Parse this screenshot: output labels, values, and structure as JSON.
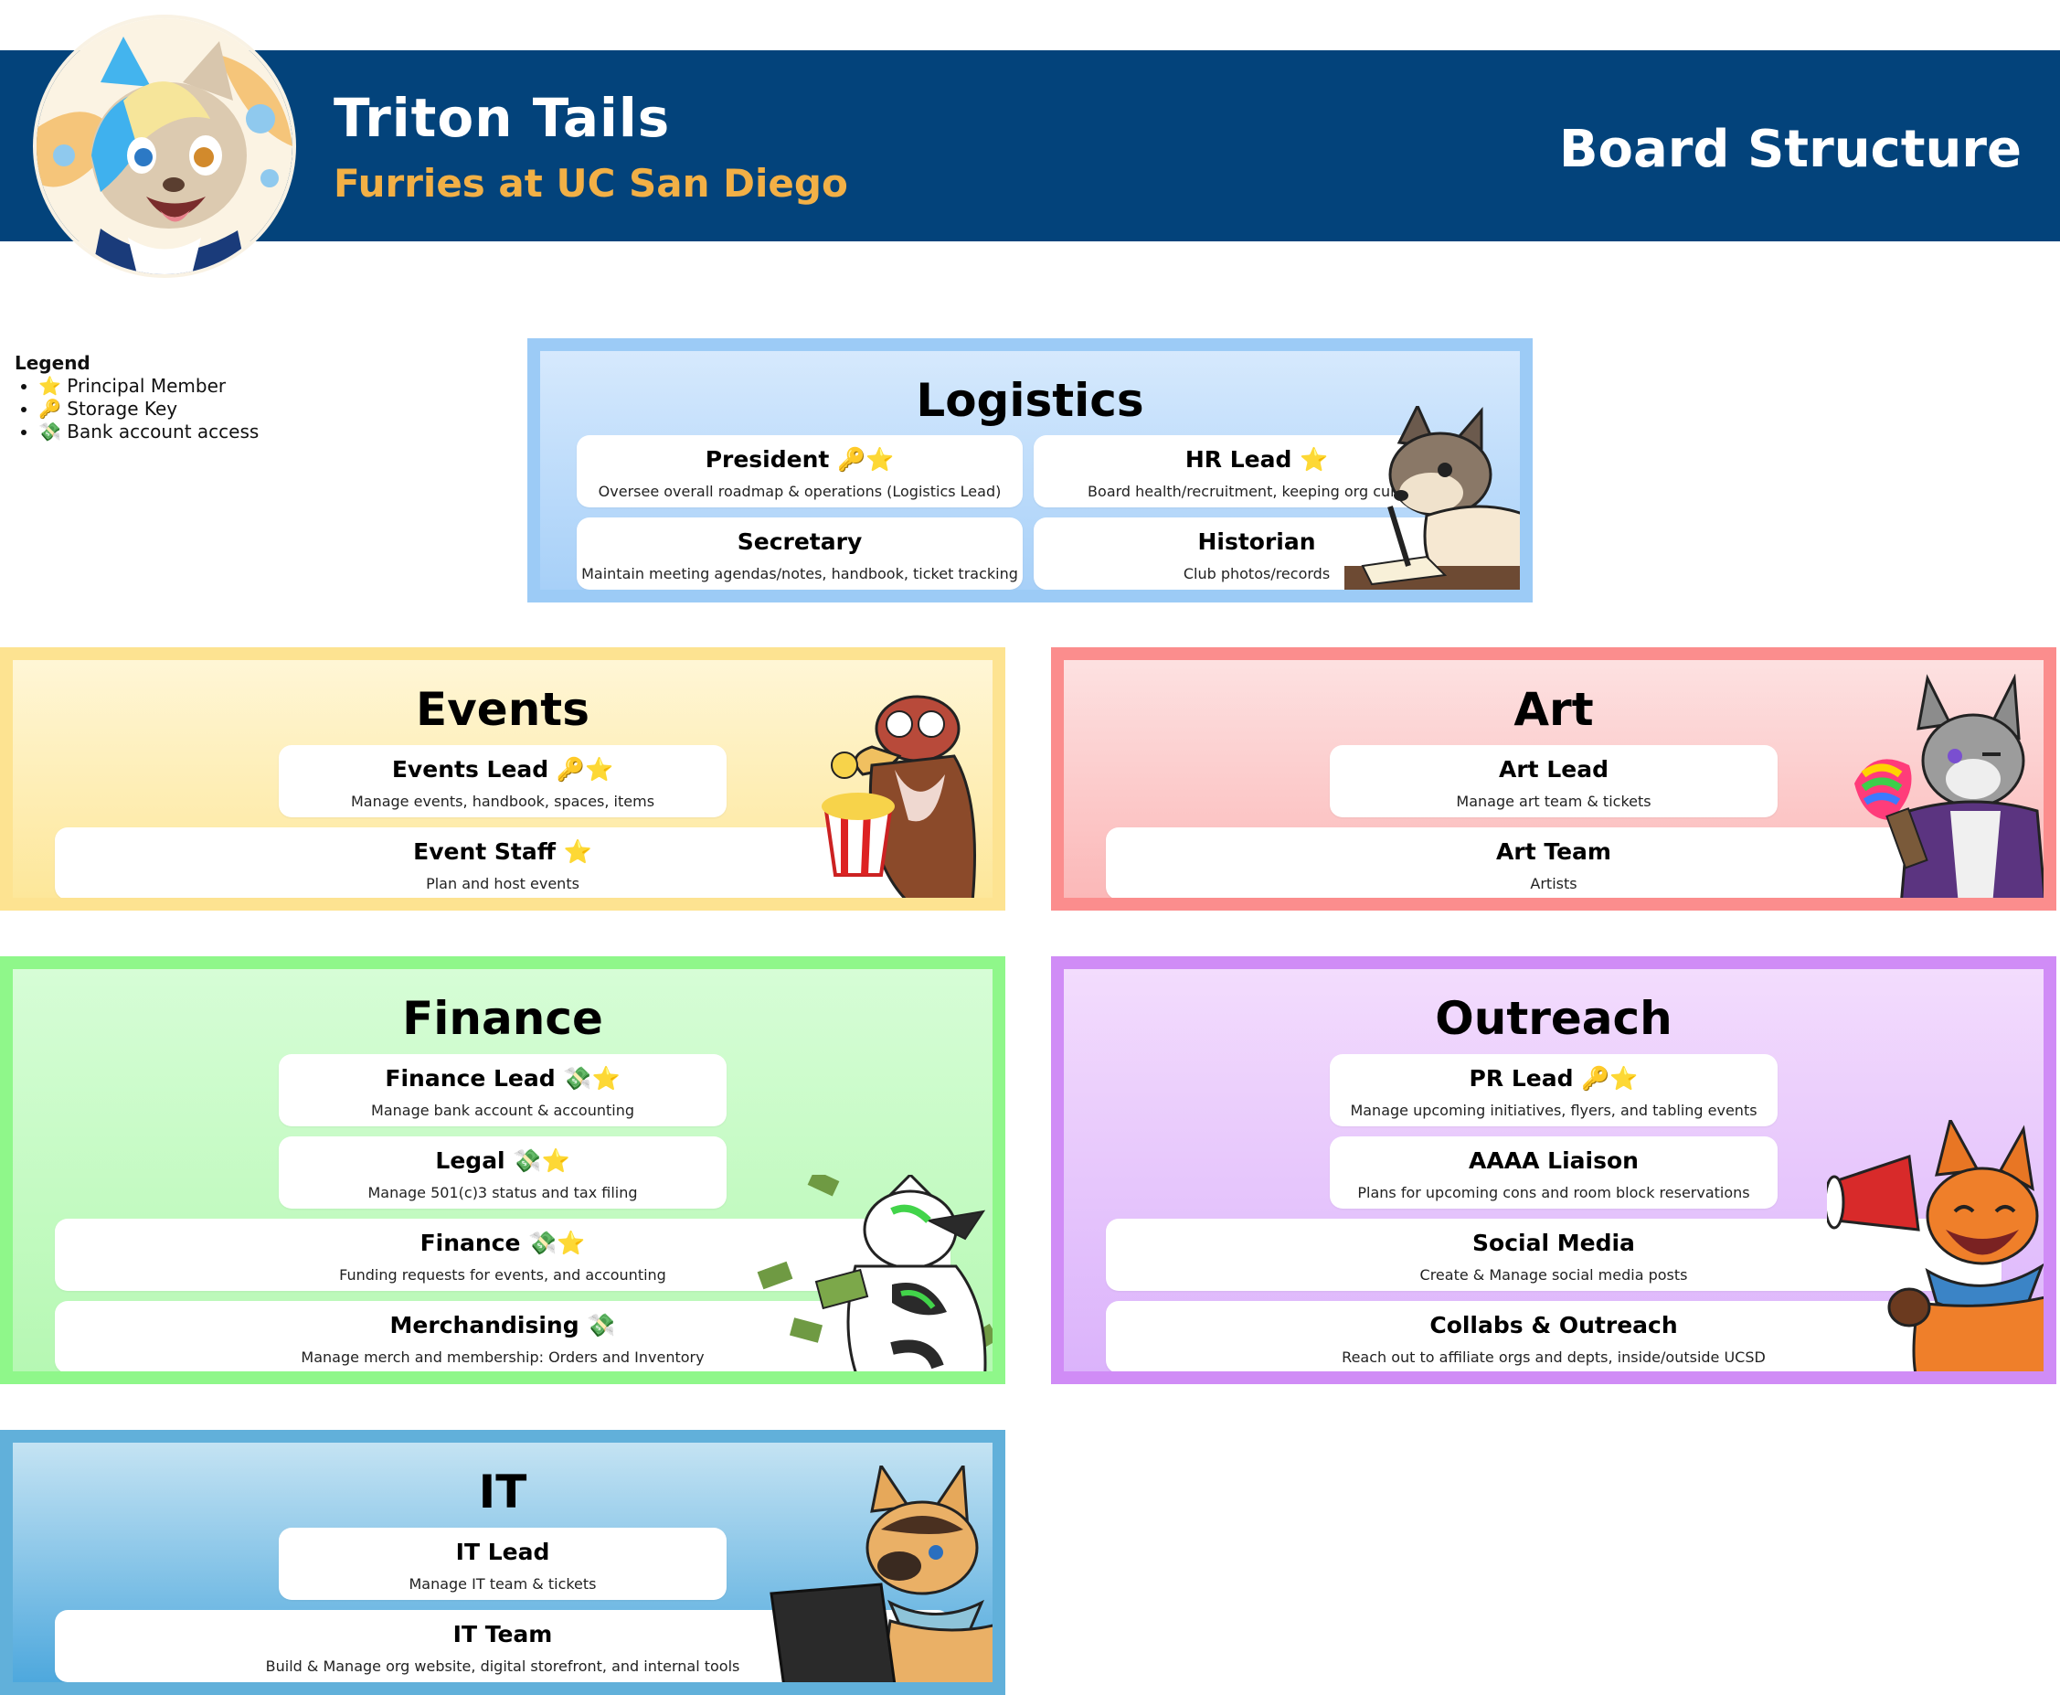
{
  "header": {
    "org_name": "Triton Tails",
    "org_subtitle": "Furries at UC San Diego",
    "doc_title": "Board Structure",
    "colors": {
      "banner": "#03437b",
      "subtitle": "#f2b046"
    }
  },
  "legend": {
    "title": "Legend",
    "items": [
      {
        "icon": "star",
        "label": "⭐ Principal Member"
      },
      {
        "icon": "key",
        "label": "🔑 Storage Key"
      },
      {
        "icon": "money-with-wings",
        "label": "💸 Bank account access"
      }
    ]
  },
  "committees": {
    "logistics": {
      "title": "Logistics",
      "roles": [
        {
          "title": "President 🔑⭐",
          "desc": "Oversee overall roadmap & operations (Logistics Lead)"
        },
        {
          "title": "HR Lead ⭐",
          "desc": "Board health/recruitment, keeping org current"
        },
        {
          "title": "Secretary",
          "desc": "Maintain meeting agendas/notes, handbook, ticket tracking"
        },
        {
          "title": "Historian",
          "desc": "Club photos/records"
        }
      ]
    },
    "events": {
      "title": "Events",
      "roles": [
        {
          "title": "Events Lead 🔑⭐",
          "desc": "Manage events, handbook, spaces, items"
        },
        {
          "title": "Event Staff ⭐",
          "desc": "Plan and host events"
        }
      ]
    },
    "art": {
      "title": "Art",
      "roles": [
        {
          "title": "Art Lead",
          "desc": "Manage art team & tickets"
        },
        {
          "title": "Art Team",
          "desc": "Artists"
        }
      ]
    },
    "finance": {
      "title": "Finance",
      "roles": [
        {
          "title": "Finance Lead 💸⭐",
          "desc": "Manage bank account & accounting"
        },
        {
          "title": "Legal 💸⭐",
          "desc": "Manage 501(c)3 status and tax filing"
        },
        {
          "title": "Finance 💸⭐",
          "desc": "Funding requests for events, and accounting"
        },
        {
          "title": "Merchandising 💸",
          "desc": "Manage merch and membership: Orders and Inventory"
        }
      ]
    },
    "outreach": {
      "title": "Outreach",
      "roles": [
        {
          "title": "PR Lead 🔑⭐",
          "desc": "Manage upcoming initiatives, flyers, and tabling events"
        },
        {
          "title": "AAAA Liaison",
          "desc": "Plans for upcoming cons and room block reservations"
        },
        {
          "title": "Social Media",
          "desc": "Create & Manage social media posts"
        },
        {
          "title": "Collabs & Outreach",
          "desc": "Reach out to affiliate orgs and depts, inside/outside UCSD"
        }
      ]
    },
    "it": {
      "title": "IT",
      "roles": [
        {
          "title": "IT Lead",
          "desc": "Manage IT team & tickets"
        },
        {
          "title": "IT Team",
          "desc": "Build & Manage org website, digital storefront, and internal tools"
        }
      ]
    }
  }
}
